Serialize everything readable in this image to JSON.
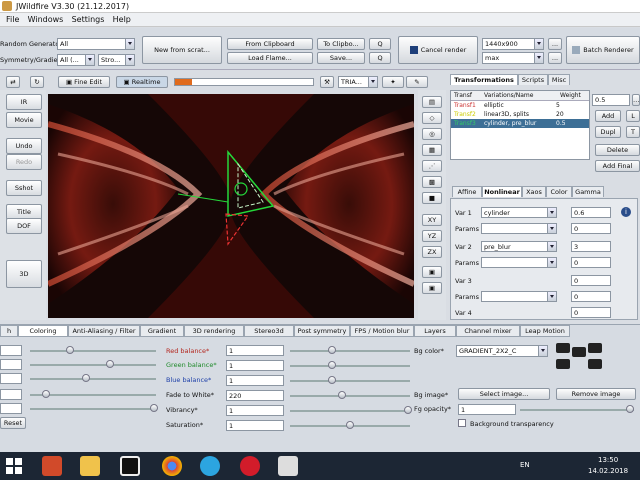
{
  "window": {
    "title": "JWildfire V3.30 (21.12.2017)"
  },
  "menu": [
    "File",
    "Windows",
    "Settings",
    "Help"
  ],
  "top": {
    "random_generator_label": "Random Generator",
    "random_generator_value": "All",
    "symmetry_label": "Symmetry/Gradient",
    "symmetry_value": "All (...",
    "stro_value": "Stro...",
    "new_from_scratch": "New from scrat...",
    "from_clipboard": "From Clipboard",
    "to_clipboard": "To Clipbo...",
    "load_flame": "Load Flame...",
    "save": "Save...",
    "q_btn": "Q",
    "cancel_render": "Cancel render",
    "resolution": "1440x900",
    "quality": "max",
    "dots": "...",
    "batch_renderer": "Batch Renderer"
  },
  "toolbar": {
    "fine_edit": "Fine Edit",
    "realtime": "Realtime",
    "triangle_mode": "TRIA..."
  },
  "left_buttons": [
    "IR",
    "Movie",
    "Undo",
    "Redo",
    "Sshot",
    "Title",
    "DOF",
    "3D"
  ],
  "side_buttons": [
    "XY",
    "YZ",
    "ZX"
  ],
  "right": {
    "tabs": [
      "Transformations",
      "Scripts",
      "Misc"
    ],
    "table_headers": [
      "Transf",
      "Variations/Name",
      "Weight"
    ],
    "rows": [
      {
        "name": "Transf1",
        "variations": "elliptic",
        "weight": "5"
      },
      {
        "name": "Transf2",
        "variations": "linear3D, splits",
        "weight": "20"
      },
      {
        "name": "Transf3",
        "variations": "cylinder, pre_blur",
        "weight": "0.5"
      }
    ],
    "spinner_value": "0.5",
    "add": "Add",
    "dupl": "Dupl",
    "delete": "Delete",
    "add_final": "Add Final",
    "l_btn": "L",
    "subtabs": [
      "Affine",
      "Nonlinear",
      "Xaos",
      "Color",
      "Gamma"
    ],
    "vars": [
      {
        "label": "Var 1",
        "name": "cylinder",
        "value": "0.6"
      },
      {
        "label": "Params",
        "name": "",
        "value": "0"
      },
      {
        "label": "Var 2",
        "name": "pre_blur",
        "value": "3"
      },
      {
        "label": "Params",
        "name": "",
        "value": "0"
      },
      {
        "label": "Var 3",
        "name": "",
        "value": "0"
      },
      {
        "label": "Params",
        "name": "",
        "value": "0"
      },
      {
        "label": "Var 4",
        "name": "",
        "value": "0"
      }
    ]
  },
  "bottom": {
    "tabs": [
      "h",
      "Coloring",
      "Anti-Aliasing / Filter",
      "Gradient",
      "3D rendering",
      "Stereo3d",
      "Post symmetry",
      "FPS / Motion blur",
      "Layers",
      "Channel mixer",
      "Leap Motion"
    ],
    "red_balance": "Red balance*",
    "red_value": "1",
    "green_balance": "Green balance*",
    "green_value": "1",
    "blue_balance": "Blue balance*",
    "blue_value": "1",
    "fade_to_white": "Fade to White*",
    "fade_value": "220",
    "vibrancy": "Vibrancy*",
    "vibrancy_value": "1",
    "saturation": "Saturation*",
    "saturation_value": "1",
    "bg_color": "Bg color*",
    "gradient_value": "GRADIENT_2X2_C",
    "bg_image": "Bg image*",
    "select_image": "Select image...",
    "remove_image": "Remove image",
    "fg_opacity": "Fg opacity*",
    "fg_value": "1",
    "bg_transparency": "Background transparency",
    "reset": "Reset"
  },
  "taskbar": {
    "lang": "EN",
    "time": "13:50",
    "date": "14.02.2018"
  }
}
